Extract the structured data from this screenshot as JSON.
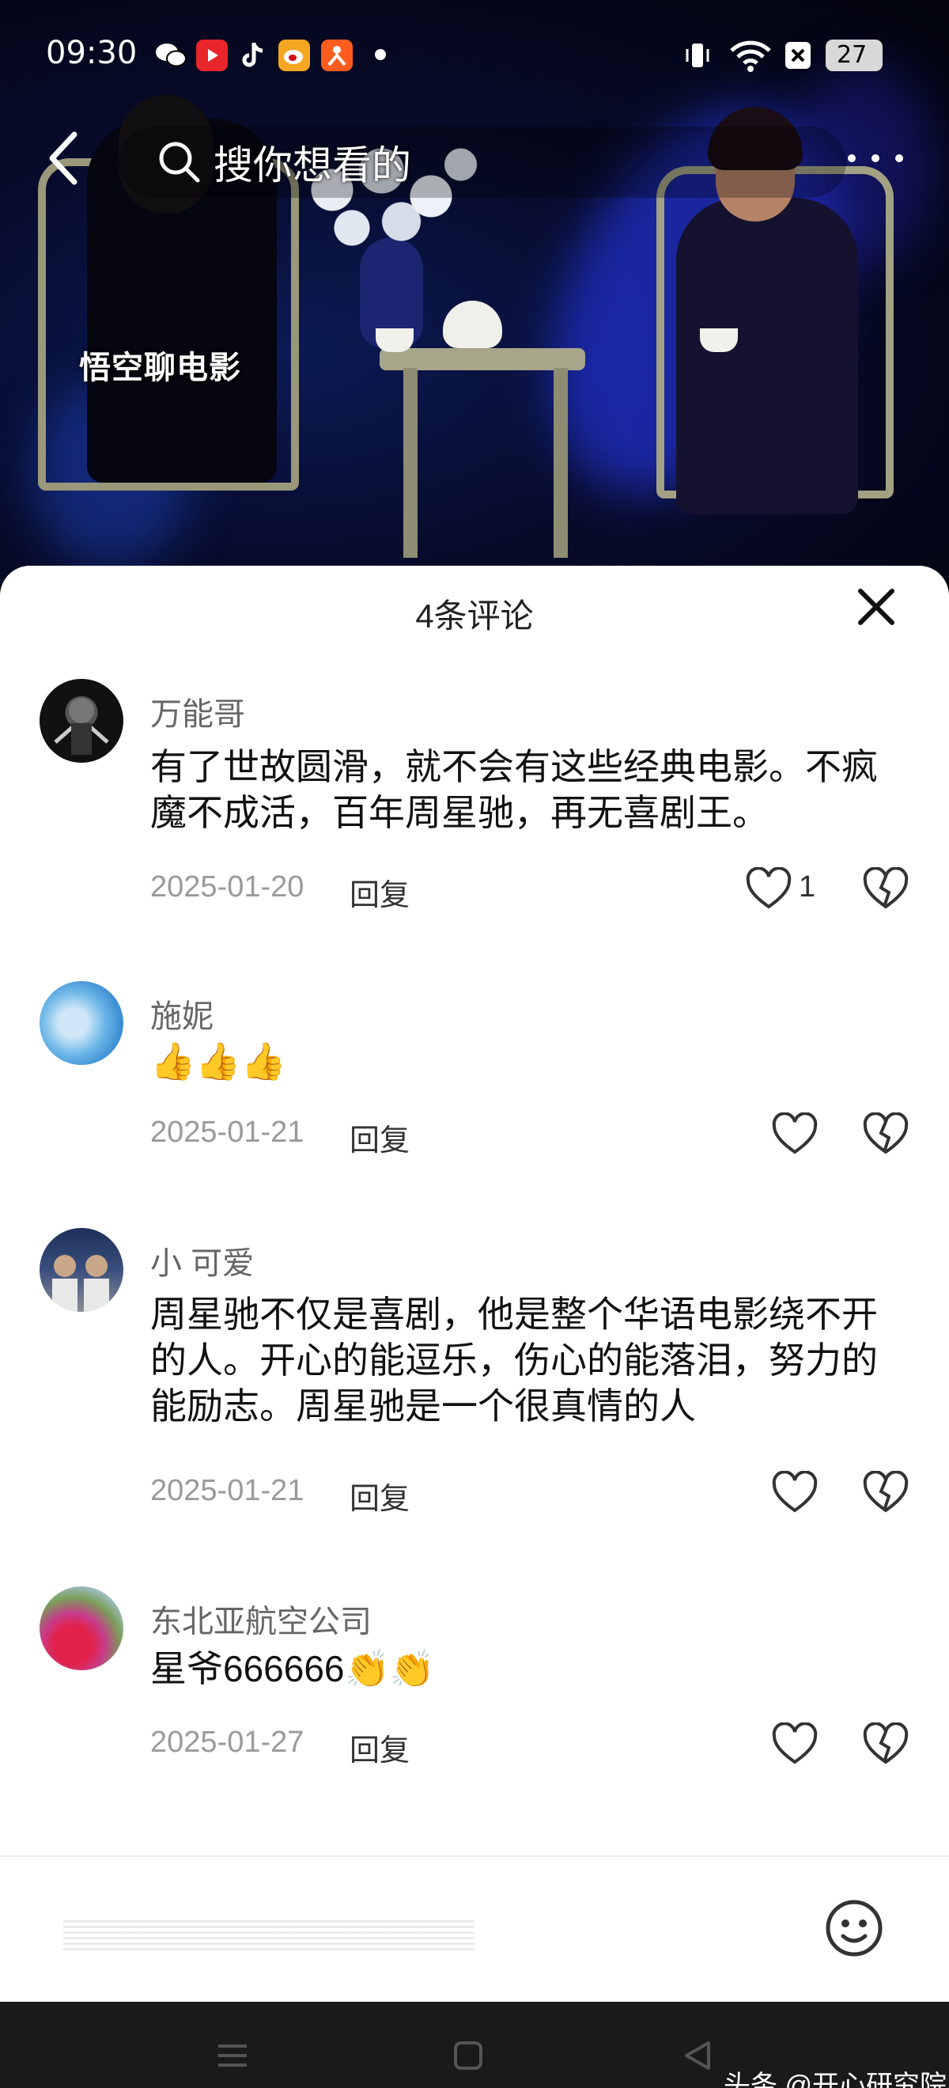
{
  "status_bar": {
    "time": "09:30",
    "battery": "27",
    "apps": [
      {
        "icon": "wechat-icon",
        "color": "#ffffff"
      },
      {
        "icon": "video-app-icon",
        "color": "#e8252a"
      },
      {
        "icon": "tiktok-icon",
        "color": "#ffffff"
      },
      {
        "icon": "weibo-icon",
        "color": "#f5a623"
      },
      {
        "icon": "app-icon",
        "color": "#ff5c1f"
      }
    ]
  },
  "video": {
    "watermark": "悟空聊电影"
  },
  "search": {
    "placeholder": "搜你想看的"
  },
  "comments_panel": {
    "title": "4条评论",
    "reply_label": "回复",
    "comments": [
      {
        "name": "万能哥",
        "text": "有了世故圆滑，就不会有这些经典电影。不疯魔不成活，百年周星驰，再无喜剧王。",
        "date": "2025-01-20",
        "likes": "1"
      },
      {
        "name": "施妮",
        "text": "👍👍👍",
        "date": "2025-01-21",
        "likes": ""
      },
      {
        "name": "小 可爱",
        "text": "周星驰不仅是喜剧，他是整个华语电影绕不开的人。开心的能逗乐，伤心的能落泪，努力的能励志。周星驰是一个很真情的人",
        "date": "2025-01-21",
        "likes": ""
      },
      {
        "name": "东北亚航空公司",
        "text": "星爷666666👏👏",
        "date": "2025-01-27",
        "likes": ""
      }
    ]
  },
  "footer": {
    "source": "头条 @开心研究院"
  }
}
